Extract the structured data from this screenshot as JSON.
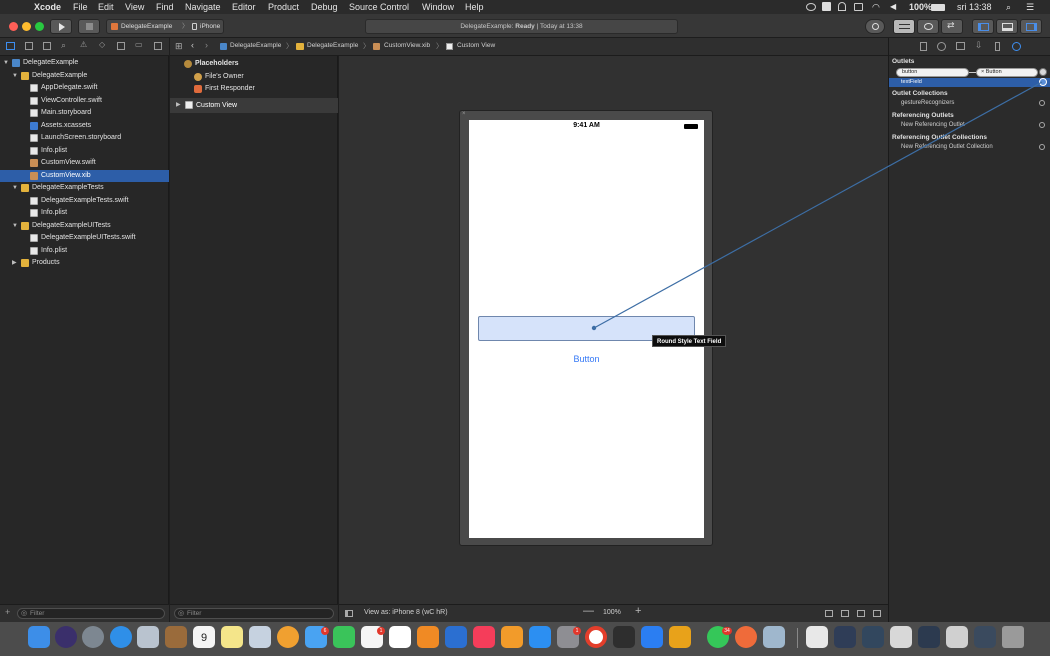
{
  "menubar": {
    "app": "Xcode",
    "items": [
      "File",
      "Edit",
      "View",
      "Find",
      "Navigate",
      "Editor",
      "Product",
      "Debug",
      "Source Control",
      "Window",
      "Help"
    ],
    "battery": "100%",
    "clock": "sri 13:38"
  },
  "toolbar": {
    "scheme": "DelegateExample",
    "device": "iPhone",
    "activity_prefix": "DelegateExample: ",
    "activity_status": "Ready",
    "activity_suffix": " | Today at 13:38"
  },
  "jumpbar": {
    "items": [
      "DelegateExample",
      "DelegateExample",
      "CustomView.xib",
      "Custom View"
    ]
  },
  "navigator": {
    "items": [
      {
        "label": "DelegateExample",
        "icon": "project-icon",
        "level": 0,
        "disclosure": "▼"
      },
      {
        "label": "DelegateExample",
        "icon": "folder-icon",
        "level": 1,
        "disclosure": "▼"
      },
      {
        "label": "AppDelegate.swift",
        "icon": "swift-file-icon",
        "level": 2
      },
      {
        "label": "ViewController.swift",
        "icon": "swift-file-icon",
        "level": 2
      },
      {
        "label": "Main.storyboard",
        "icon": "storyboard-icon",
        "level": 2
      },
      {
        "label": "Assets.xcassets",
        "icon": "assets-icon",
        "level": 2
      },
      {
        "label": "LaunchScreen.storyboard",
        "icon": "storyboard-icon",
        "level": 2
      },
      {
        "label": "Info.plist",
        "icon": "plist-icon",
        "level": 2
      },
      {
        "label": "CustomView.swift",
        "icon": "swift-file-icon",
        "level": 2
      },
      {
        "label": "CustomView.xib",
        "icon": "xib-icon",
        "level": 2,
        "selected": true
      },
      {
        "label": "DelegateExampleTests",
        "icon": "folder-icon",
        "level": 1,
        "disclosure": "▼"
      },
      {
        "label": "DelegateExampleTests.swift",
        "icon": "swift-file-icon",
        "level": 2
      },
      {
        "label": "Info.plist",
        "icon": "plist-icon",
        "level": 2
      },
      {
        "label": "DelegateExampleUITests",
        "icon": "folder-icon",
        "level": 1,
        "disclosure": "▼"
      },
      {
        "label": "DelegateExampleUITests.swift",
        "icon": "swift-file-icon",
        "level": 2
      },
      {
        "label": "Info.plist",
        "icon": "plist-icon",
        "level": 2
      },
      {
        "label": "Products",
        "icon": "folder-icon",
        "level": 1,
        "disclosure": "▶"
      }
    ],
    "filter_placeholder": "Filter"
  },
  "outline": {
    "placeholders": "Placeholders",
    "files_owner": "File's Owner",
    "first_responder": "First Responder",
    "custom_view": "Custom View",
    "filter_placeholder": "Filter"
  },
  "canvas": {
    "status_time": "9:41 AM",
    "button_label": "Button",
    "tooltip": "Round Style Text Field",
    "view_as_prefix": "View as: ",
    "view_as_device": "iPhone 8 (",
    "view_as_suffix": "wC hR)",
    "zoom": "100%"
  },
  "inspector": {
    "outlets_title": "Outlets",
    "outlet_button": "button",
    "outlet_button_target": "Button",
    "outlet_textfield": "textField",
    "outlet_collections_title": "Outlet Collections",
    "gesture_recognizers": "gestureRecognizers",
    "referencing_outlets_title": "Referencing Outlets",
    "new_referencing_outlet": "New Referencing Outlet",
    "referencing_collections_title": "Referencing Outlet Collections",
    "new_referencing_collection": "New Referencing Outlet Collection"
  },
  "dock": {
    "calendar_day": "9",
    "mail_badge": "6",
    "reminders_badge": "1",
    "news_badge": "1",
    "whatsapp_badge": "34"
  },
  "colors": {
    "selection": "#2d5ea8",
    "accent": "#3478f6",
    "textfield_fill": "#d6e3fa",
    "connection_line": "#3d6ea5"
  }
}
